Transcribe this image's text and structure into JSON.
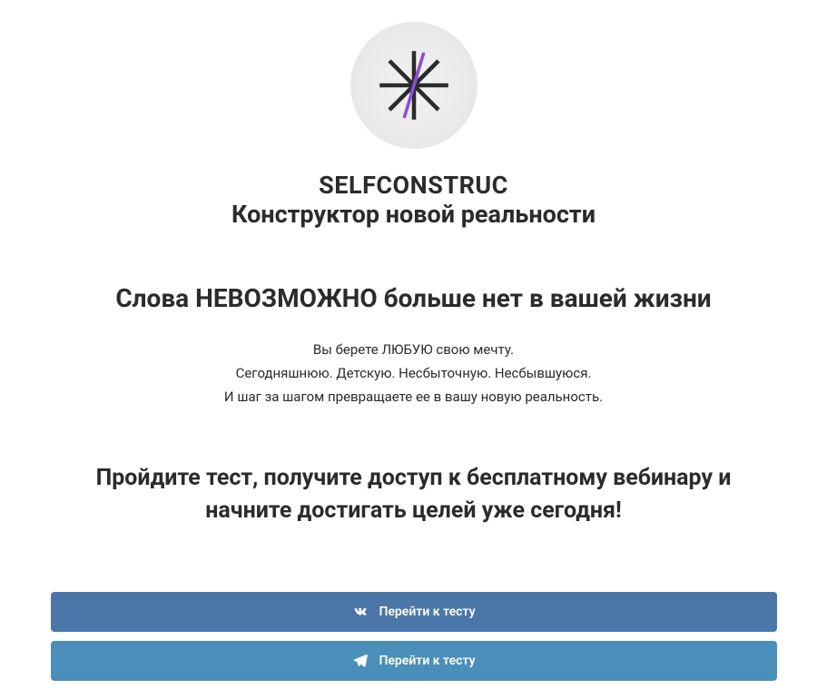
{
  "brand": {
    "name": "SELFCONSTRUC",
    "subtitle": "Конструктор новой реальности"
  },
  "headline": "Слова НЕВОЗМОЖНО больше нет в вашей жизни",
  "body": {
    "line1": "Вы берете ЛЮБУЮ свою мечту.",
    "line2": "Сегодняшнюю. Детскую. Несбыточную. Несбывшуюся.",
    "line3": "И шаг за шагом превращаете ее в вашу новую реальность."
  },
  "cta_heading": "Пройдите тест, получите доступ к бесплатному вебинару и начните достигать целей уже сегодня!",
  "buttons": {
    "vk_label": "Перейти к тесту",
    "tg_label": "Перейти к тесту"
  },
  "colors": {
    "vk": "#4a76a8",
    "tg": "#4a8fba",
    "text": "#2b2b2b",
    "accent_purple": "#8a4fd6"
  }
}
